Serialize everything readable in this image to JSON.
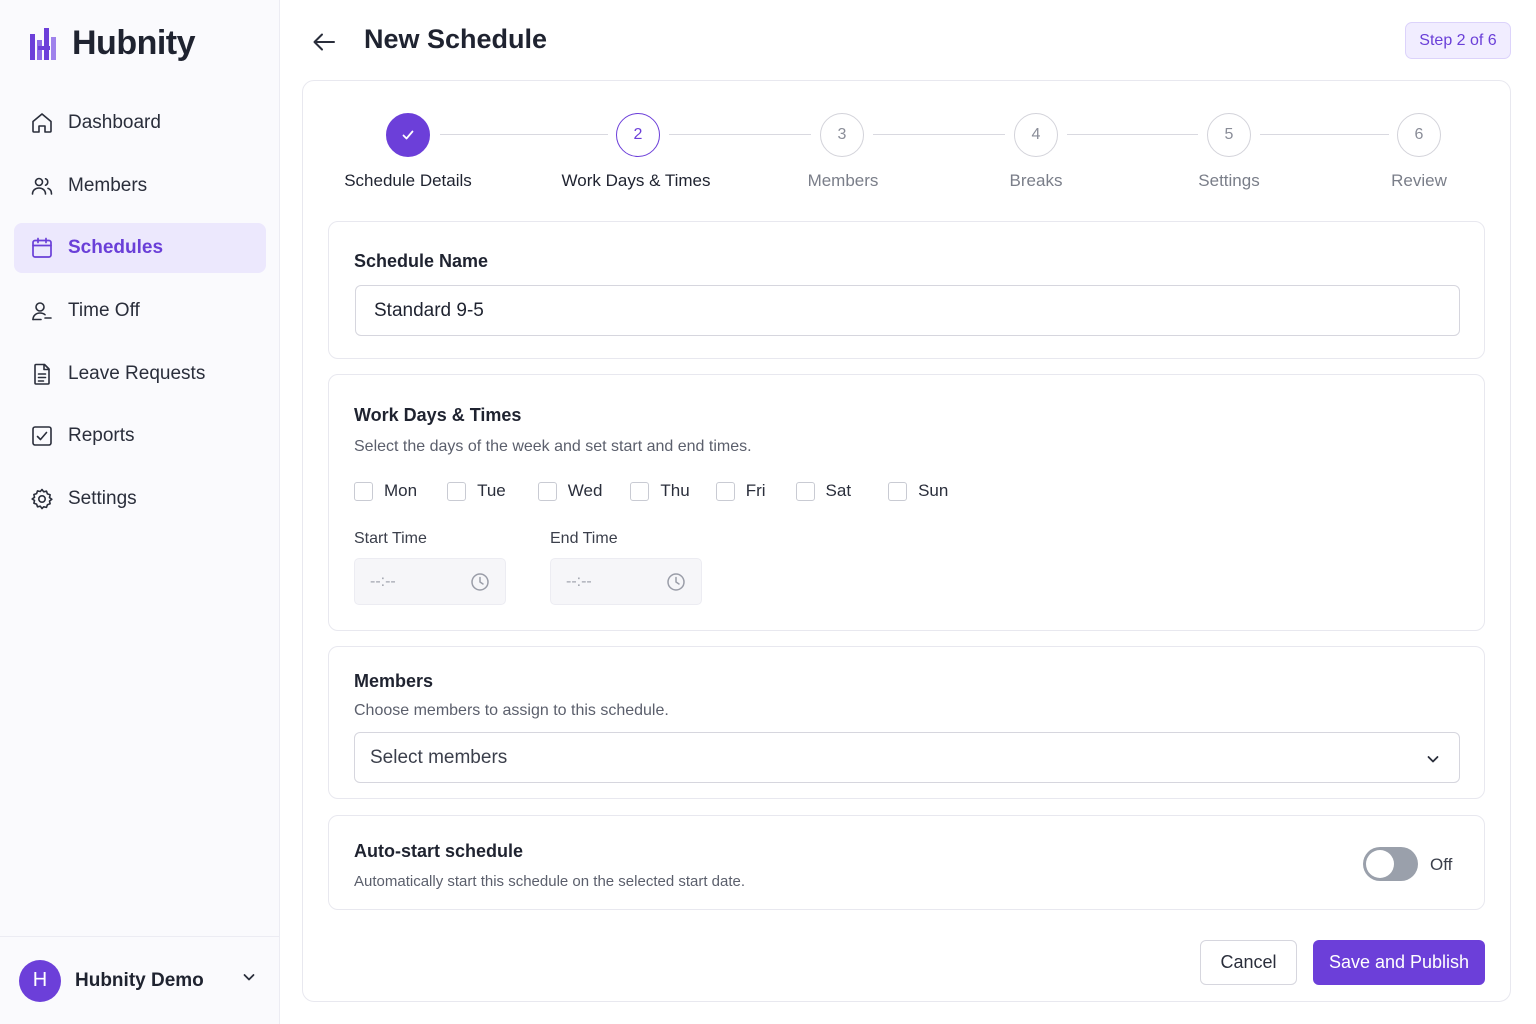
{
  "brand": {
    "name": "Hubnity"
  },
  "sidebar": {
    "items": [
      {
        "label": "Dashboard",
        "icon": "home-icon"
      },
      {
        "label": "Members",
        "icon": "users-icon"
      },
      {
        "label": "Schedules",
        "icon": "calendar-icon",
        "active": true
      },
      {
        "label": "Time Off",
        "icon": "user-minus-icon"
      },
      {
        "label": "Leave Requests",
        "icon": "document-icon"
      },
      {
        "label": "Reports",
        "icon": "check-square-icon"
      },
      {
        "label": "Settings",
        "icon": "gear-icon"
      }
    ],
    "user": {
      "initial": "H",
      "name": "Hubnity Demo"
    }
  },
  "header": {
    "title": "New Schedule",
    "step_badge": "Step 2 of 6"
  },
  "stepper": {
    "steps": [
      {
        "number": "1",
        "label": "Schedule Details",
        "state": "done"
      },
      {
        "number": "2",
        "label": "Work Days & Times",
        "state": "current"
      },
      {
        "number": "3",
        "label": "Members",
        "state": "upcoming"
      },
      {
        "number": "4",
        "label": "Breaks",
        "state": "upcoming"
      },
      {
        "number": "5",
        "label": "Settings",
        "state": "upcoming"
      },
      {
        "number": "6",
        "label": "Review",
        "state": "upcoming"
      }
    ]
  },
  "schedule_name": {
    "title": "Schedule Name",
    "value": "Standard 9-5"
  },
  "work_days": {
    "title": "Work Days & Times",
    "subtitle": "Select the days of the week and set start and end times.",
    "days": [
      {
        "label": "Mon",
        "checked": false
      },
      {
        "label": "Tue",
        "checked": false
      },
      {
        "label": "Wed",
        "checked": false
      },
      {
        "label": "Thu",
        "checked": false
      },
      {
        "label": "Fri",
        "checked": false
      },
      {
        "label": "Sat",
        "checked": false
      },
      {
        "label": "Sun",
        "checked": false
      }
    ],
    "start_label": "Start Time",
    "start_placeholder": "--:--",
    "end_label": "End Time",
    "end_placeholder": "--:--"
  },
  "members": {
    "title": "Members",
    "subtitle": "Choose members to assign to this schedule.",
    "select_placeholder": "Select members"
  },
  "auto_start": {
    "title": "Auto-start schedule",
    "subtitle": "Automatically start this schedule on the selected start date.",
    "state_label": "Off",
    "enabled": false
  },
  "actions": {
    "cancel_label": "Cancel",
    "save_label": "Save and Publish"
  },
  "colors": {
    "accent": "#6c3fd9",
    "accent_light": "#ece8fd",
    "toggle_off": "#9aa0ab"
  }
}
